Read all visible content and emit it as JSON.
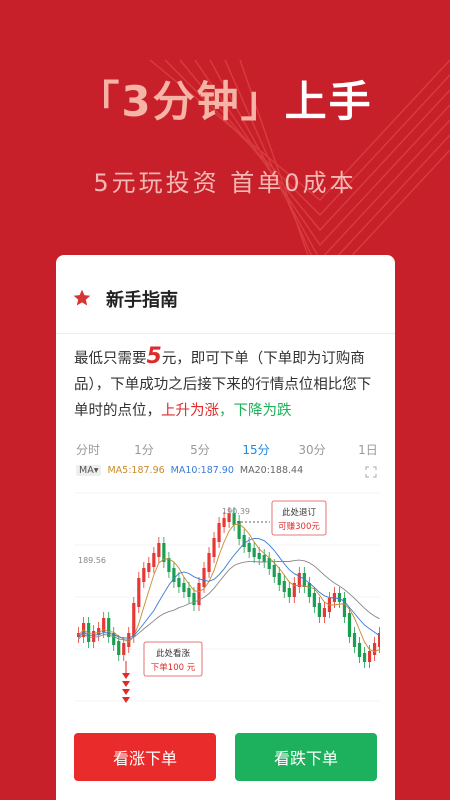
{
  "hero": {
    "title_open": "「",
    "title_highlight": "3分钟",
    "title_close": "」",
    "title_tail": "上手",
    "subtitle": "5元玩投资   首单0成本"
  },
  "card": {
    "title": "新手指南",
    "description": {
      "part1": "最低只需要",
      "amount": "5",
      "part2": "元，即可下单（下单即为订购商品），下单成功之后接下来的行情点位相比您下单时的点位，",
      "rise_text": "上升为涨",
      "comma": "，",
      "fall_text": "下降为跌"
    },
    "tabs": [
      "分时",
      "1分",
      "5分",
      "15分",
      "30分",
      "1日"
    ],
    "active_tab": "15分",
    "ma": {
      "selector": "MA",
      "ma5": "MA5:187.96",
      "ma10": "MA10:187.90",
      "ma20": "MA20:188.44"
    },
    "chart": {
      "price_high": "190.39",
      "price_mid": "189.56",
      "exit_label": "此处退订",
      "profit_label": "可赚300元",
      "entry_label": "此处看涨",
      "order_label": "下单100 元"
    },
    "buttons": {
      "buy_up": "看涨下单",
      "buy_down": "看跌下单"
    }
  },
  "colors": {
    "background": "#c8202a",
    "rise": "#e02a2a",
    "fall": "#1fb25a",
    "active_tab": "#1e88e5"
  },
  "chart_data": {
    "type": "candlestick",
    "y_tick_labels": [
      "190.39",
      "189.56"
    ],
    "series": [
      {
        "name": "MA5",
        "value": "187.96"
      },
      {
        "name": "MA10",
        "value": "187.90"
      },
      {
        "name": "MA20",
        "value": "188.44"
      }
    ]
  }
}
